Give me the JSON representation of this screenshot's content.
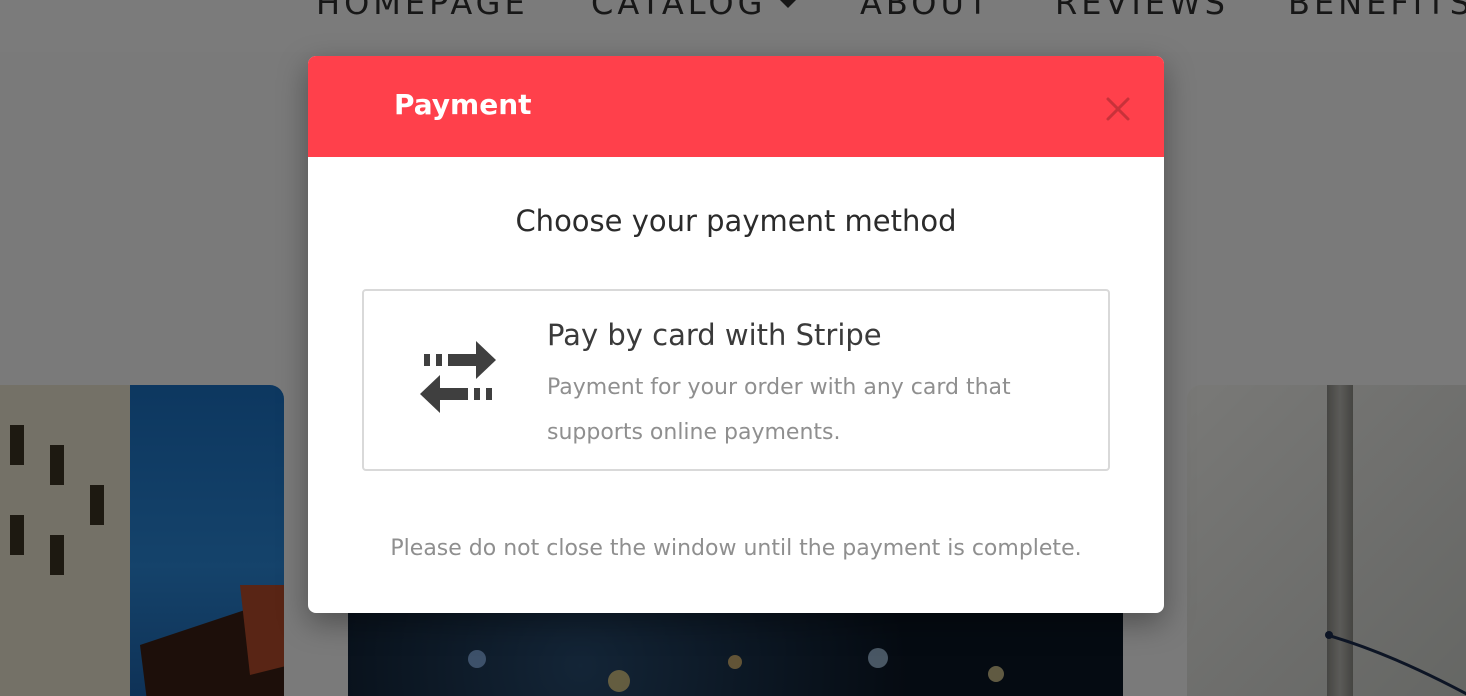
{
  "nav": {
    "items": [
      {
        "label": "HOMEPAGE"
      },
      {
        "label": "CATALOG",
        "has_dropdown": true
      },
      {
        "label": "ABOUT"
      },
      {
        "label": "REVIEWS"
      },
      {
        "label": "BENEFITS"
      }
    ]
  },
  "modal": {
    "title": "Payment",
    "close_icon": "close-icon",
    "subtitle": "Choose your payment method",
    "methods": [
      {
        "icon": "transfer-arrows-icon",
        "title": "Pay by card with Stripe",
        "description": "Payment for your order with any card that supports online payments."
      }
    ],
    "note": "Please do not close the window until the payment is complete."
  },
  "colors": {
    "header": "#ff404b",
    "overlay": "rgba(0,0,0,0.5)"
  }
}
